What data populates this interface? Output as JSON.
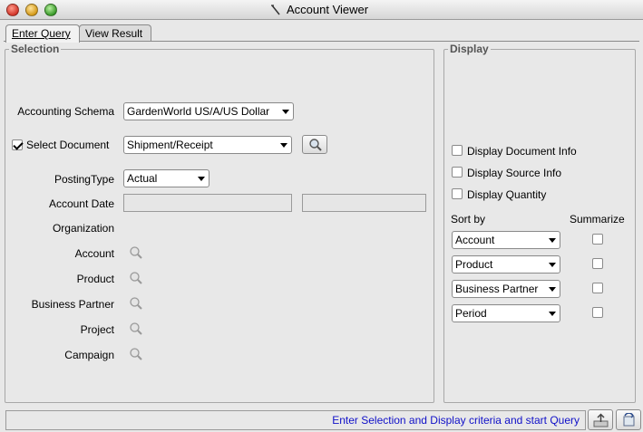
{
  "window": {
    "title": "Account Viewer"
  },
  "tabs": [
    {
      "label": "Enter Query"
    },
    {
      "label": "View Result"
    }
  ],
  "selection": {
    "title": "Selection",
    "accounting_schema": {
      "label": "Accounting Schema",
      "value": "GardenWorld US/A/US Dollar"
    },
    "select_document": {
      "label": "Select Document",
      "checked": true,
      "value": "Shipment/Receipt"
    },
    "posting_type": {
      "label": "PostingType",
      "value": "Actual"
    },
    "account_date": {
      "label": "Account Date"
    },
    "organization": {
      "label": "Organization"
    },
    "account": {
      "label": "Account"
    },
    "product": {
      "label": "Product"
    },
    "business_partner": {
      "label": "Business Partner"
    },
    "project": {
      "label": "Project"
    },
    "campaign": {
      "label": "Campaign"
    }
  },
  "display": {
    "title": "Display",
    "options": [
      {
        "label": "Display Document Info"
      },
      {
        "label": "Display Source Info"
      },
      {
        "label": "Display Quantity"
      }
    ],
    "sort_by_label": "Sort by",
    "summarize_label": "Summarize",
    "sort_fields": [
      {
        "value": "Account"
      },
      {
        "value": "Product"
      },
      {
        "value": "Business Partner"
      },
      {
        "value": "Period"
      }
    ]
  },
  "status": {
    "text": "Enter Selection and Display criteria and start Query"
  },
  "colors": {
    "status_text": "#1010c8"
  }
}
